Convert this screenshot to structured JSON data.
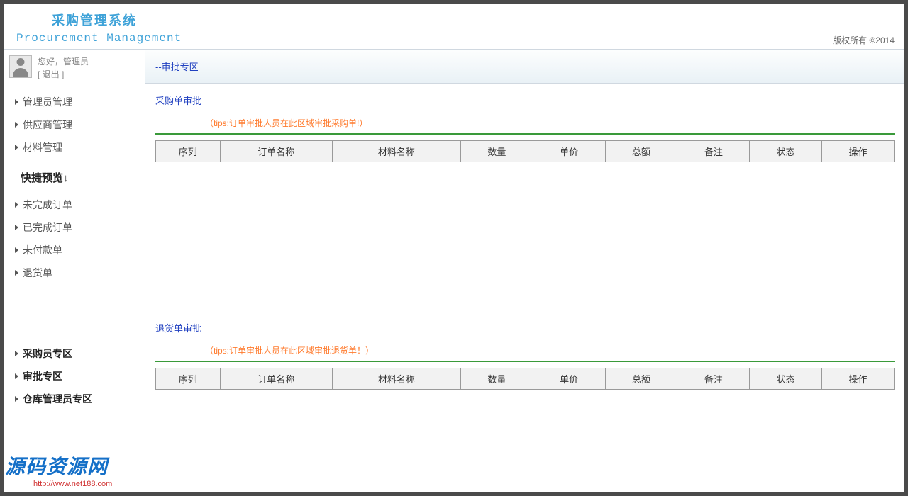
{
  "header": {
    "title": "采购管理系统",
    "subtitle": "Procurement Management",
    "copyright": "版权所有 ©2014"
  },
  "user": {
    "greeting": "您好，管理员",
    "logout": "[ 退出 ]"
  },
  "nav": {
    "group1": [
      {
        "label": "管理员管理"
      },
      {
        "label": "供应商管理"
      },
      {
        "label": "材料管理"
      }
    ],
    "quick_label": "快捷预览↓",
    "group2": [
      {
        "label": "未完成订单"
      },
      {
        "label": "已完成订单"
      },
      {
        "label": "未付款单"
      },
      {
        "label": "退货单"
      }
    ],
    "group3": [
      {
        "label": "采购员专区"
      },
      {
        "label": "审批专区"
      },
      {
        "label": "仓库管理员专区"
      }
    ]
  },
  "panel": {
    "title": "--审批专区"
  },
  "sections": [
    {
      "title": "采购单审批",
      "hint": "（tips:订单审批人员在此区域审批采购单!）"
    },
    {
      "title": "退货单审批",
      "hint": "（tips:订单审批人员在此区域审批退货单！）"
    }
  ],
  "table_headers": [
    "序列",
    "订单名称",
    "材料名称",
    "数量",
    "单价",
    "总额",
    "备注",
    "状态",
    "操作"
  ],
  "col_widths": [
    "8%",
    "14%",
    "16%",
    "9%",
    "9%",
    "9%",
    "9%",
    "9%",
    "9%"
  ],
  "watermark": {
    "text": "源码资源网",
    "url": "http://www.net188.com"
  }
}
